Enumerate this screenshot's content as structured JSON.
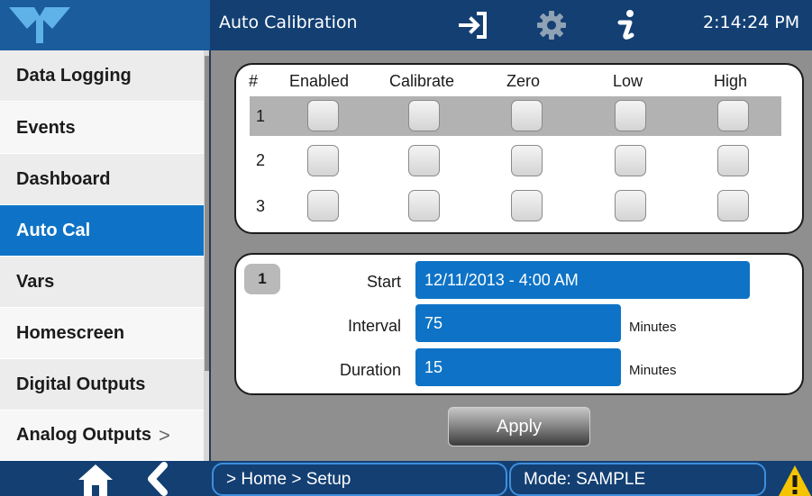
{
  "header": {
    "title": "Auto Calibration",
    "clock": "2:14:24 PM",
    "icons": [
      "logo-icon",
      "sign-in-icon",
      "gear-icon",
      "info-icon"
    ]
  },
  "sidebar": {
    "items": [
      {
        "label": "Data Logging"
      },
      {
        "label": "Events"
      },
      {
        "label": "Dashboard"
      },
      {
        "label": "Auto Cal",
        "active": true
      },
      {
        "label": "Vars"
      },
      {
        "label": "Homescreen"
      },
      {
        "label": "Digital Outputs"
      },
      {
        "label": "Analog Outputs",
        "chevron": ">"
      }
    ]
  },
  "table": {
    "columns": [
      "#",
      "Enabled",
      "Calibrate",
      "Zero",
      "Low",
      "High"
    ],
    "rows": [
      {
        "num": "1",
        "selected": true
      },
      {
        "num": "2",
        "selected": false
      },
      {
        "num": "3",
        "selected": false
      }
    ]
  },
  "details": {
    "selected_num": "1",
    "start_label": "Start",
    "start_value": "12/11/2013 - 4:00 AM",
    "interval_label": "Interval",
    "interval_value": "75",
    "interval_unit": "Minutes",
    "duration_label": "Duration",
    "duration_value": "15",
    "duration_unit": "Minutes"
  },
  "apply_label": "Apply",
  "footer": {
    "icons": [
      "home-icon",
      "back-icon",
      "warning-icon"
    ],
    "breadcrumb": "> Home > Setup",
    "mode": "Mode: SAMPLE"
  },
  "colors": {
    "header_bg": "#133f72",
    "accent_blue": "#0e73c6",
    "warning_yellow": "#f5c400"
  }
}
